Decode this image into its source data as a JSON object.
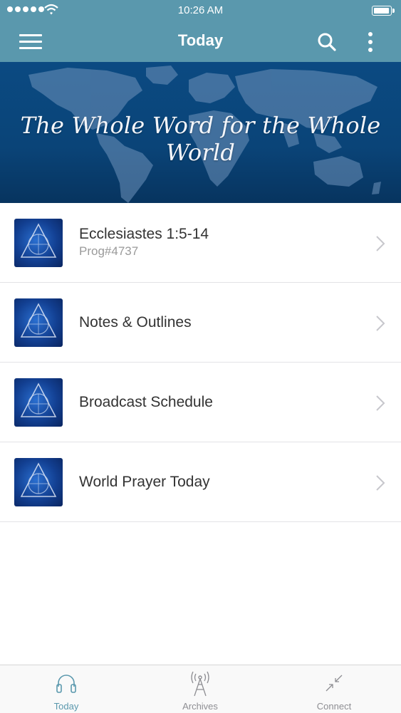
{
  "status_bar": {
    "time": "10:26 AM"
  },
  "nav": {
    "title": "Today",
    "menu_icon": "menu-icon",
    "search_icon": "search-icon",
    "more_icon": "more-vertical-icon"
  },
  "banner": {
    "tagline": "The Whole Word for the Whole World"
  },
  "list": {
    "items": [
      {
        "title": "Ecclesiastes 1:5-14",
        "subtitle": "Prog#4737"
      },
      {
        "title": "Notes & Outlines"
      },
      {
        "title": "Broadcast Schedule"
      },
      {
        "title": "World Prayer Today"
      }
    ]
  },
  "tabs": [
    {
      "label": "Today",
      "icon": "headphones-icon",
      "active": true
    },
    {
      "label": "Archives",
      "icon": "radio-tower-icon",
      "active": false
    },
    {
      "label": "Connect",
      "icon": "arrows-in-icon",
      "active": false
    }
  ],
  "colors": {
    "accent": "#5a98ad",
    "banner": "#0b4a82",
    "text": "#333333",
    "subtitle": "#9a9a9a"
  }
}
